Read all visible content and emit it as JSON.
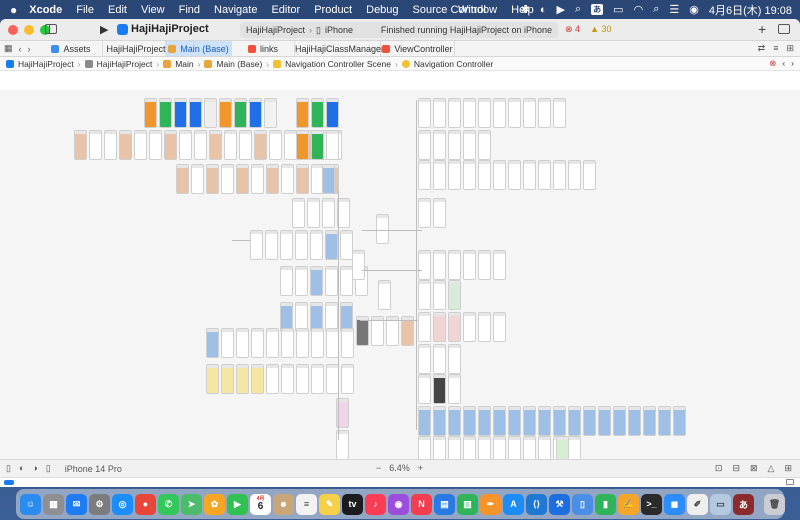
{
  "menubar": {
    "app": "Xcode",
    "items": [
      "File",
      "Edit",
      "View",
      "Find",
      "Navigate",
      "Editor",
      "Product",
      "Debug",
      "Source Control"
    ],
    "center_items": [
      "Window",
      "Help"
    ],
    "ime": "あ",
    "clock": "4月6日(木) 19:08"
  },
  "toolbar": {
    "project_title": "HajiHajiProject",
    "scheme_project": "HajiHajiProject",
    "scheme_device": "iPhone",
    "status": "Finished running HajiHajiProject on iPhone",
    "errors": "4",
    "warnings": "30"
  },
  "tabs": [
    {
      "label": "Assets",
      "icon_color": "#3b8ef3",
      "active": false
    },
    {
      "label": "HajiHajiProject",
      "icon_color": "#1a7cf5",
      "active": false
    },
    {
      "label": "Main (Base)",
      "icon_color": "#e9a43a",
      "active": true
    },
    {
      "label": "links",
      "icon_color": "#f05138",
      "active": false
    },
    {
      "label": "HajiHajiClassManager",
      "icon_color": "#f05138",
      "active": false
    },
    {
      "label": "ViewController",
      "icon_color": "#f05138",
      "active": false
    }
  ],
  "jumpbar": {
    "items": [
      "HajiHajiProject",
      "HajiHajiProject",
      "Main",
      "Main (Base)",
      "Navigation Controller Scene",
      "Navigation Controller"
    ]
  },
  "bottombar": {
    "device": "iPhone 14 Pro",
    "zoom": "6.4%",
    "zoom_out": "−",
    "zoom_in": "+"
  },
  "dock": {
    "calendar_day": "6",
    "calendar_month": "4月",
    "apps": [
      {
        "name": "finder",
        "color": "#2a8cf0",
        "glyph": "☺"
      },
      {
        "name": "launchpad",
        "color": "#8e8e93",
        "glyph": "▦"
      },
      {
        "name": "mail",
        "color": "#1f7cf2",
        "glyph": "✉"
      },
      {
        "name": "system-settings",
        "color": "#7c7c80",
        "glyph": "⚙"
      },
      {
        "name": "safari",
        "color": "#1c8ef9",
        "glyph": "◎"
      },
      {
        "name": "chrome",
        "color": "#e9463a",
        "glyph": "●"
      },
      {
        "name": "messages",
        "color": "#34c759",
        "glyph": "✆"
      },
      {
        "name": "maps",
        "color": "#4cbb6c",
        "glyph": "➤"
      },
      {
        "name": "photos",
        "color": "#f6a623",
        "glyph": "✿"
      },
      {
        "name": "facetime",
        "color": "#30c152",
        "glyph": "▶"
      },
      {
        "name": "calendar",
        "color": "#ffffff",
        "glyph": ""
      },
      {
        "name": "contacts",
        "color": "#c8a67a",
        "glyph": "☻"
      },
      {
        "name": "reminders",
        "color": "#f2f2f2",
        "glyph": "≡"
      },
      {
        "name": "notes",
        "color": "#f7d04a",
        "glyph": "✎"
      },
      {
        "name": "tv",
        "color": "#1c1c1e",
        "glyph": "tv"
      },
      {
        "name": "music",
        "color": "#fa3c55",
        "glyph": "♪"
      },
      {
        "name": "podcasts",
        "color": "#9b4ddb",
        "glyph": "◉"
      },
      {
        "name": "news",
        "color": "#f43e4f",
        "glyph": "N"
      },
      {
        "name": "keynote",
        "color": "#2a7ae4",
        "glyph": "▤"
      },
      {
        "name": "numbers",
        "color": "#2fb45a",
        "glyph": "▥"
      },
      {
        "name": "pages",
        "color": "#f4942a",
        "glyph": "✒"
      },
      {
        "name": "app-store",
        "color": "#1d8cf6",
        "glyph": "A"
      },
      {
        "name": "vscode",
        "color": "#1f78d1",
        "glyph": "⟨⟩"
      },
      {
        "name": "xcode",
        "color": "#1d6fe0",
        "glyph": "⚒"
      },
      {
        "name": "simulator",
        "color": "#4b8ee6",
        "glyph": "▯"
      },
      {
        "name": "activity",
        "color": "#2fb45a",
        "glyph": "▮"
      },
      {
        "name": "pages-2",
        "color": "#f4a62a",
        "glyph": "✍"
      },
      {
        "name": "terminal",
        "color": "#2b2b2b",
        "glyph": ">_"
      },
      {
        "name": "zoom",
        "color": "#2d8cff",
        "glyph": "◼"
      },
      {
        "name": "textedit",
        "color": "#eeeeee",
        "glyph": "✐"
      },
      {
        "name": "preview",
        "color": "#b4c8e0",
        "glyph": "▭"
      },
      {
        "name": "dictionary",
        "color": "#8b2b2b",
        "glyph": "あ"
      },
      {
        "name": "trash",
        "color": "#c9ccd2",
        "glyph": "🗑"
      }
    ]
  }
}
